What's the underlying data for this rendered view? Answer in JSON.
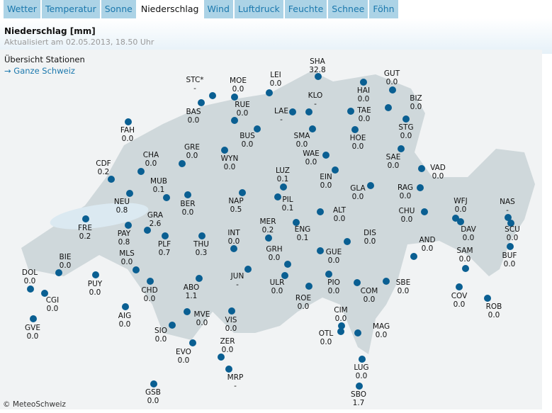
{
  "tabs": [
    "Wetter",
    "Temperatur",
    "Sonne",
    "Niederschlag",
    "Wind",
    "Luftdruck",
    "Feuchte",
    "Schnee",
    "Föhn"
  ],
  "active_tab": "Niederschlag",
  "title": "Niederschlag [mm]",
  "updated": "Aktualisiert am 02.05.2013, 18.50 Uhr",
  "overview_label": "Übersicht Stationen",
  "all_link": "→ Ganze Schweiz",
  "copyright": "© MeteoSchweiz",
  "colors": {
    "dot": "#0a5f92",
    "tab_bg": "#acd3e6",
    "link": "#1b78ad"
  },
  "stations": [
    {
      "code": "SHA",
      "value": "32.8"
    },
    {
      "code": "LEI",
      "value": "0.0"
    },
    {
      "code": "MOE",
      "value": "0.0"
    },
    {
      "code": "STC*",
      "value": "-"
    },
    {
      "code": "RUE",
      "value": "0.0"
    },
    {
      "code": "BAS",
      "value": "0.0"
    },
    {
      "code": "KLO",
      "value": "-"
    },
    {
      "code": "LAE",
      "value": "-"
    },
    {
      "code": "HAI",
      "value": "0.0"
    },
    {
      "code": "GUT",
      "value": "0.0"
    },
    {
      "code": "BIZ",
      "value": "0.0"
    },
    {
      "code": "TAE",
      "value": "0.0"
    },
    {
      "code": "STG",
      "value": "0.0"
    },
    {
      "code": "HOE",
      "value": "0.0"
    },
    {
      "code": "SMA",
      "value": "0.0"
    },
    {
      "code": "BUS",
      "value": "0.0"
    },
    {
      "code": "FAH",
      "value": "0.0"
    },
    {
      "code": "GRE",
      "value": "0.0"
    },
    {
      "code": "WYN",
      "value": "0.0"
    },
    {
      "code": "WAE",
      "value": "0.0"
    },
    {
      "code": "SAE",
      "value": "0.0"
    },
    {
      "code": "CHA",
      "value": "0.0"
    },
    {
      "code": "CDF",
      "value": "0.2"
    },
    {
      "code": "LUZ",
      "value": "0.1"
    },
    {
      "code": "EIN",
      "value": "0.0"
    },
    {
      "code": "VAD",
      "value": "0.0"
    },
    {
      "code": "MUB",
      "value": "0.1"
    },
    {
      "code": "GLA",
      "value": "0.0"
    },
    {
      "code": "RAG",
      "value": "0.0"
    },
    {
      "code": "NEU",
      "value": "0.8"
    },
    {
      "code": "BER",
      "value": "0.0"
    },
    {
      "code": "NAP",
      "value": "0.5"
    },
    {
      "code": "PIL",
      "value": "0.1"
    },
    {
      "code": "ALT",
      "value": "0.0"
    },
    {
      "code": "CHU",
      "value": "0.0"
    },
    {
      "code": "WFJ",
      "value": "0.0"
    },
    {
      "code": "NAS",
      "value": "-"
    },
    {
      "code": "GRA",
      "value": "2.6"
    },
    {
      "code": "FRE",
      "value": "0.2"
    },
    {
      "code": "PAY",
      "value": "0.8"
    },
    {
      "code": "MER",
      "value": "0.2"
    },
    {
      "code": "ENG",
      "value": "0.1"
    },
    {
      "code": "DAV",
      "value": "0.0"
    },
    {
      "code": "SCU",
      "value": "0.0"
    },
    {
      "code": "INT",
      "value": "0.0"
    },
    {
      "code": "DIS",
      "value": "0.0"
    },
    {
      "code": "PLF",
      "value": "0.7"
    },
    {
      "code": "THU",
      "value": "0.3"
    },
    {
      "code": "AND",
      "value": "0.0"
    },
    {
      "code": "GRH",
      "value": "0.0"
    },
    {
      "code": "GUE",
      "value": "0.0"
    },
    {
      "code": "SAM",
      "value": "0.0"
    },
    {
      "code": "BIE",
      "value": "0.0"
    },
    {
      "code": "MLS",
      "value": "0.0"
    },
    {
      "code": "BUF",
      "value": "0.0"
    },
    {
      "code": "DOL",
      "value": "0.0"
    },
    {
      "code": "JUN",
      "value": "-"
    },
    {
      "code": "PUY",
      "value": "0.0"
    },
    {
      "code": "ABO",
      "value": "1.1"
    },
    {
      "code": "ULR",
      "value": "0.0"
    },
    {
      "code": "PIO",
      "value": "0.0"
    },
    {
      "code": "SBE",
      "value": "0.0"
    },
    {
      "code": "CHD",
      "value": "0.0"
    },
    {
      "code": "CGI",
      "value": "0.0"
    },
    {
      "code": "COM",
      "value": "0.0"
    },
    {
      "code": "ROE",
      "value": "0.0"
    },
    {
      "code": "COV",
      "value": "0.0"
    },
    {
      "code": "ROB",
      "value": "0.0"
    },
    {
      "code": "AIG",
      "value": "0.0"
    },
    {
      "code": "MVE",
      "value": "0.0"
    },
    {
      "code": "CIM",
      "value": "0.0"
    },
    {
      "code": "VIS",
      "value": "0.0"
    },
    {
      "code": "GVE",
      "value": "0.0"
    },
    {
      "code": "MAG",
      "value": "0.0"
    },
    {
      "code": "SIO",
      "value": "0.0"
    },
    {
      "code": "OTL",
      "value": "0.0"
    },
    {
      "code": "ZER",
      "value": "0.0"
    },
    {
      "code": "EVO",
      "value": "0.0"
    },
    {
      "code": "LUG",
      "value": "0.0"
    },
    {
      "code": "MRP",
      "value": "-"
    },
    {
      "code": "GSB",
      "value": "0.0"
    },
    {
      "code": "SBO",
      "value": "1.7"
    }
  ]
}
